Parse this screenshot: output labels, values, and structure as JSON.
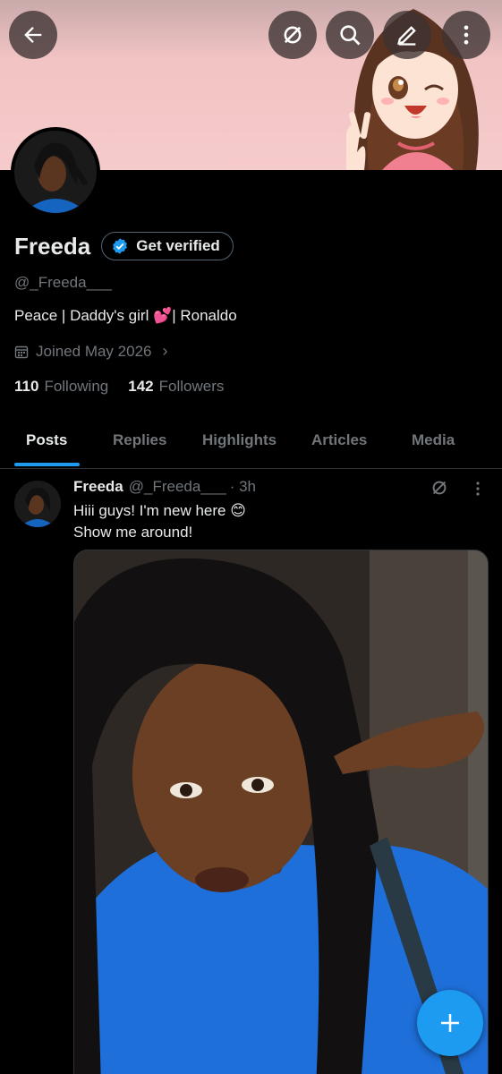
{
  "profile": {
    "display_name": "Freeda",
    "verify_label": "Get verified",
    "handle": "@_Freeda___",
    "bio": "Peace | Daddy's girl 💕| Ronaldo",
    "joined": "Joined May 2026",
    "following_count": "110",
    "following_label": "Following",
    "followers_count": "142",
    "followers_label": "Followers"
  },
  "tabs": [
    {
      "label": "Posts",
      "active": true
    },
    {
      "label": "Replies",
      "active": false
    },
    {
      "label": "Highlights",
      "active": false
    },
    {
      "label": "Articles",
      "active": false
    },
    {
      "label": "Media",
      "active": false
    }
  ],
  "post": {
    "author": "Freeda",
    "handle": "@_Freeda___",
    "time": "· 3h",
    "line1": "Hiii guys! I'm new here 😊",
    "line2": "Show me around!"
  },
  "icons": [
    "back-arrow-icon",
    "grok-icon",
    "search-icon",
    "edit-icon",
    "more-vertical-icon",
    "verified-badge-icon",
    "calendar-icon",
    "chevron-right-icon",
    "plus-icon"
  ],
  "colors": {
    "accent": "#1d9bf0",
    "banner": "#f6cbcb",
    "background": "#000000",
    "secondary_text": "#71767b"
  }
}
